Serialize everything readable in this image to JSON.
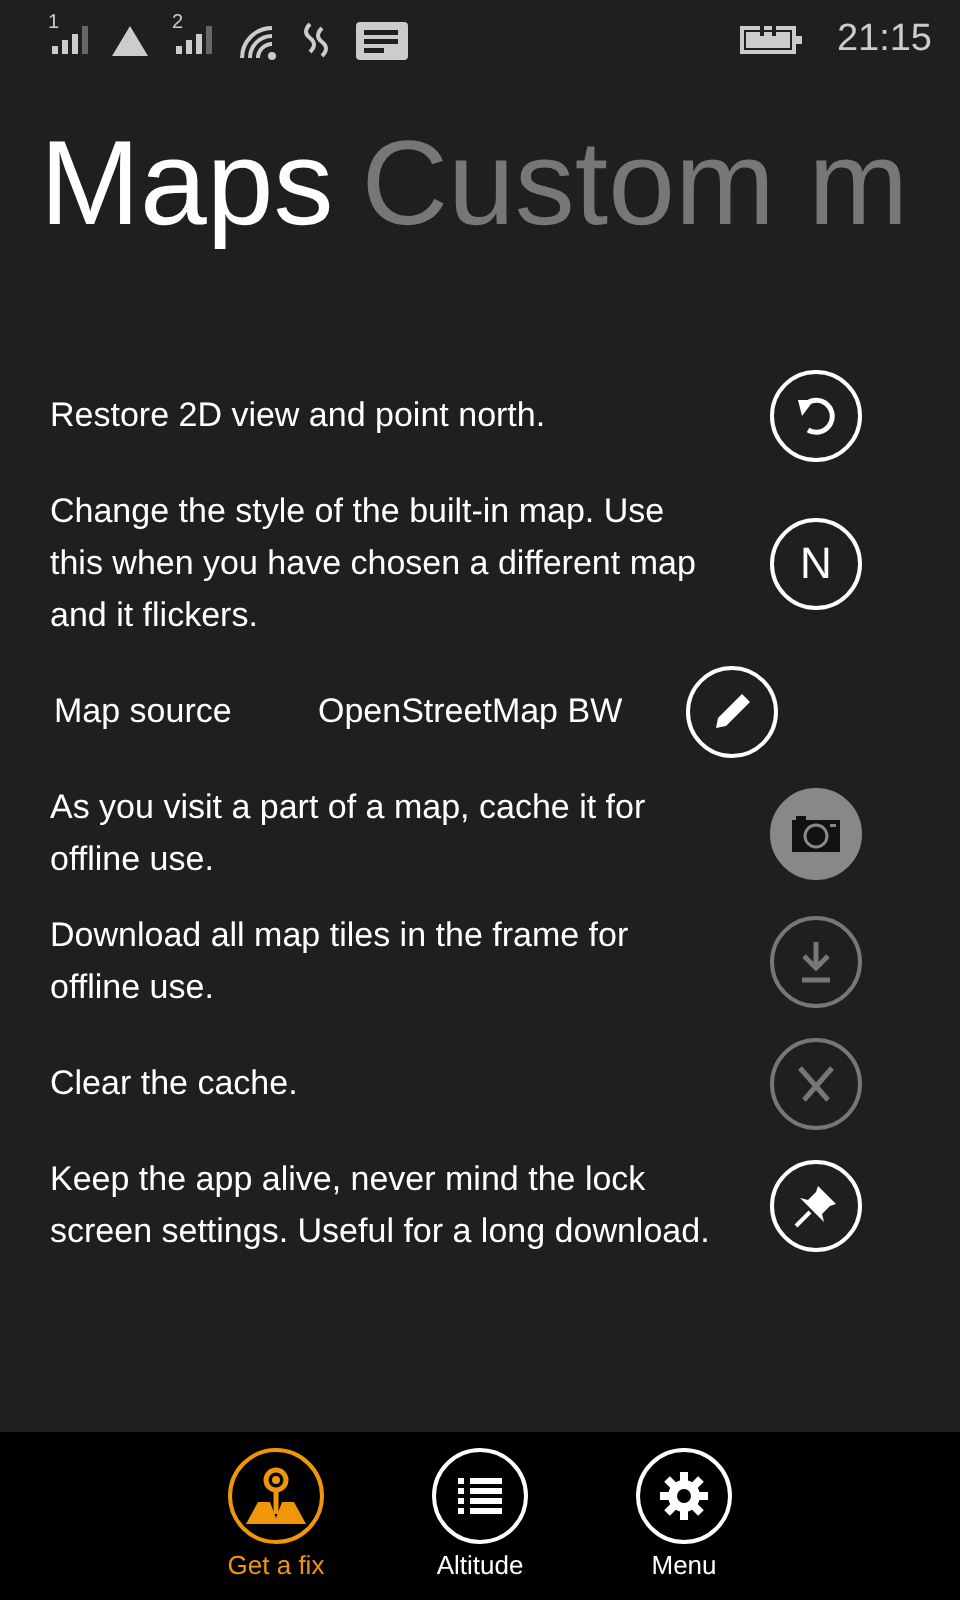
{
  "status_bar": {
    "sim_1": "1",
    "sim_2": "2",
    "time": "21:15"
  },
  "pivot": [
    {
      "label": "Maps",
      "selected": true
    },
    {
      "label": "Custom m",
      "selected": false
    }
  ],
  "settings": [
    {
      "kind": "action",
      "text": "Restore 2D view and point north.",
      "disabled": false,
      "on": false
    },
    {
      "kind": "action",
      "text": "Change the style of the built-in map. Use this when you have chosen a different map and it flickers.",
      "glyph": "N",
      "disabled": false,
      "on": false
    },
    {
      "kind": "source",
      "label": "Map source",
      "value": "OpenStreetMap BW"
    },
    {
      "kind": "action",
      "text": "As you visit a part of a map, cache it for offline use.",
      "disabled": false,
      "on": true
    },
    {
      "kind": "action",
      "text": "Download all map tiles in the frame for offline use.",
      "disabled": true,
      "on": false
    },
    {
      "kind": "action",
      "text": "Clear the cache.",
      "disabled": true,
      "on": false
    },
    {
      "kind": "action",
      "text": "Keep the app alive, never mind the lock screen settings. Useful for a long download.",
      "disabled": false,
      "on": false
    }
  ],
  "app_bar": [
    {
      "label": "Get a fix",
      "selected": true
    },
    {
      "label": "Altitude",
      "selected": false
    },
    {
      "label": "Menu",
      "selected": false
    }
  ]
}
